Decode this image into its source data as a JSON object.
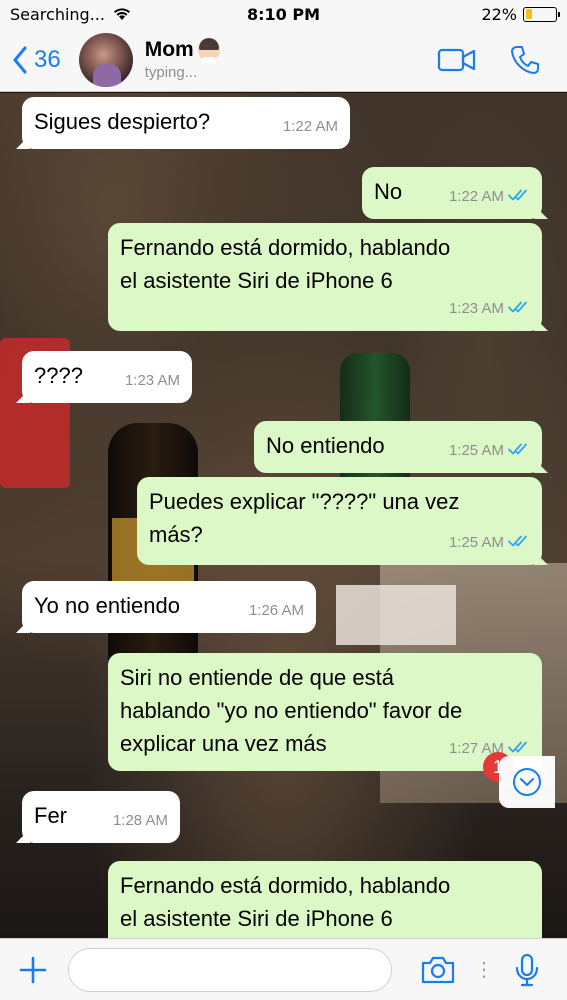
{
  "status_bar": {
    "carrier": "Searching...",
    "time": "8:10 PM",
    "battery": "22%",
    "battery_level": 0.22
  },
  "header": {
    "back_count": "36",
    "contact_name": "Mom",
    "contact_status": "typing..."
  },
  "messages": [
    {
      "dir": "in",
      "text": "Sigues despierto?",
      "time": "1:22 AM"
    },
    {
      "dir": "out",
      "text": "No",
      "time": "1:22 AM"
    },
    {
      "dir": "out",
      "text": "Fernando está dormido, hablando\nel asistente Siri de iPhone 6",
      "time": "1:23 AM"
    },
    {
      "dir": "in",
      "text": "????",
      "time": "1:23 AM"
    },
    {
      "dir": "out",
      "text": "No entiendo",
      "time": "1:25 AM"
    },
    {
      "dir": "out",
      "text": "Puedes explicar \"????\" una vez\nmás?",
      "time": "1:25 AM"
    },
    {
      "dir": "in",
      "text": "Yo no entiendo",
      "time": "1:26 AM"
    },
    {
      "dir": "out",
      "text": "Siri no entiende de que está\nhablando \"yo no entiendo\" favor de\nexplicar una vez más",
      "time": "1:27 AM"
    },
    {
      "dir": "in",
      "text": "Fer",
      "time": "1:28 AM"
    },
    {
      "dir": "out",
      "text": "Fernando está dormido, hablando\nel asistente Siri de iPhone 6",
      "time": ""
    }
  ],
  "unread_badge": "1",
  "input": {
    "placeholder": ""
  },
  "colors": {
    "accent": "#1a7cf5",
    "outgoing_bubble": "#dcf8c6",
    "incoming_bubble": "#ffffff",
    "read_ticks": "#34a6f2",
    "badge": "#e53935"
  },
  "icons": {
    "back": "chevron-left-icon",
    "video": "video-camera-icon",
    "call": "phone-icon",
    "add": "plus-icon",
    "camera": "camera-icon",
    "mic": "microphone-icon",
    "scroll": "chevron-down-circle-icon"
  }
}
